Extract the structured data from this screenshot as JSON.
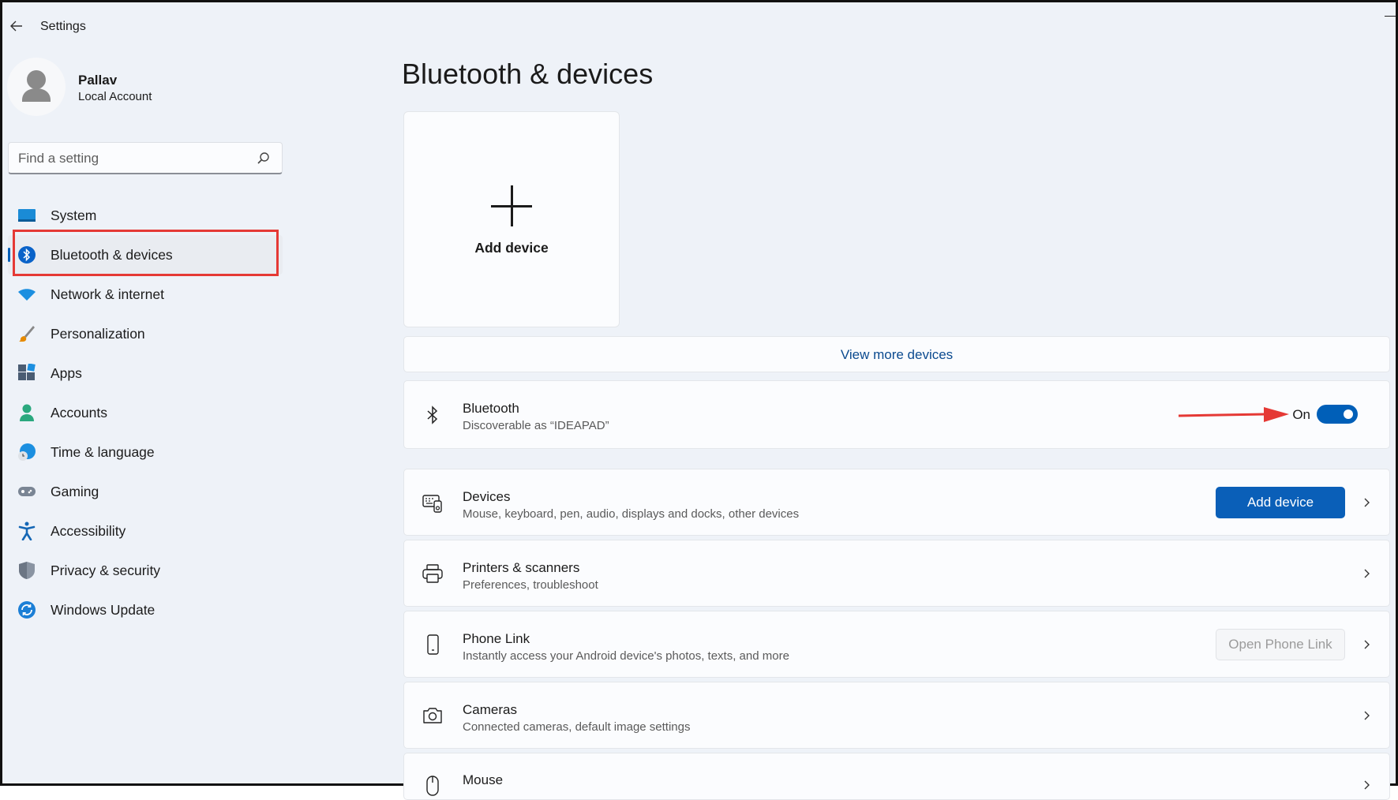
{
  "window": {
    "title": "Settings"
  },
  "profile": {
    "name": "Pallav",
    "account_type": "Local Account"
  },
  "search": {
    "placeholder": "Find a setting"
  },
  "sidebar": {
    "items": [
      {
        "label": "System",
        "icon": "system-icon"
      },
      {
        "label": "Bluetooth & devices",
        "icon": "bluetooth-icon",
        "selected": true
      },
      {
        "label": "Network & internet",
        "icon": "wifi-icon"
      },
      {
        "label": "Personalization",
        "icon": "brush-icon"
      },
      {
        "label": "Apps",
        "icon": "apps-icon"
      },
      {
        "label": "Accounts",
        "icon": "accounts-icon"
      },
      {
        "label": "Time & language",
        "icon": "globe-clock-icon"
      },
      {
        "label": "Gaming",
        "icon": "gamepad-icon"
      },
      {
        "label": "Accessibility",
        "icon": "accessibility-icon"
      },
      {
        "label": "Privacy & security",
        "icon": "shield-icon"
      },
      {
        "label": "Windows Update",
        "icon": "update-icon"
      }
    ]
  },
  "main": {
    "title": "Bluetooth & devices",
    "add_tile_label": "Add device",
    "view_more": "View more devices",
    "bluetooth": {
      "title": "Bluetooth",
      "subtitle": "Discoverable as “IDEAPAD”",
      "state_label": "On",
      "enabled": true
    },
    "devices": {
      "title": "Devices",
      "subtitle": "Mouse, keyboard, pen, audio, displays and docks, other devices",
      "button": "Add device"
    },
    "printers": {
      "title": "Printers & scanners",
      "subtitle": "Preferences, troubleshoot"
    },
    "phone_link": {
      "title": "Phone Link",
      "subtitle": "Instantly access your Android device's photos, texts, and more",
      "button": "Open Phone Link"
    },
    "cameras": {
      "title": "Cameras",
      "subtitle": "Connected cameras, default image settings"
    },
    "mouse": {
      "title": "Mouse"
    }
  },
  "colors": {
    "accent": "#005fb8",
    "annotation": "#e53935",
    "background": "#eef2f8"
  }
}
